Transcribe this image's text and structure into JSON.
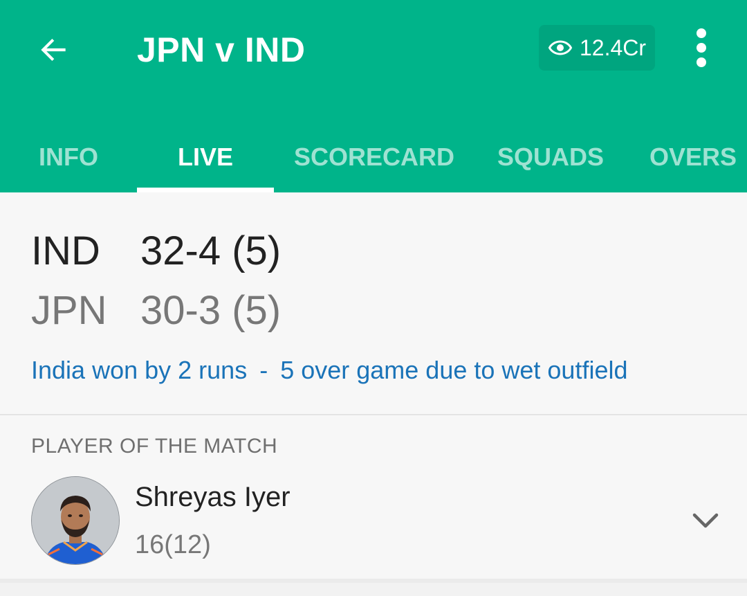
{
  "header": {
    "title": "JPN v IND",
    "views": "12.4Cr",
    "back_icon": "arrow-left-icon",
    "views_icon": "eye-icon",
    "menu_icon": "more-vertical-icon",
    "background_color": "#00b48a"
  },
  "tabs": [
    {
      "label": "INFO",
      "active": false
    },
    {
      "label": "LIVE",
      "active": true
    },
    {
      "label": "SCORECARD",
      "active": false
    },
    {
      "label": "SQUADS",
      "active": false
    },
    {
      "label": "OVERS",
      "active": false
    }
  ],
  "score": {
    "team1": {
      "abbr": "IND",
      "score": "32-4 (5)"
    },
    "team2": {
      "abbr": "JPN",
      "score": "30-3 (5)"
    },
    "result": "India won by 2 runs",
    "separator": "-",
    "note": "5 over game due to wet outfield",
    "result_color": "#1a73b8"
  },
  "player_of_match": {
    "label": "PLAYER OF THE MATCH",
    "name": "Shreyas Iyer",
    "stat": "16(12)",
    "expand_icon": "chevron-down-icon"
  }
}
